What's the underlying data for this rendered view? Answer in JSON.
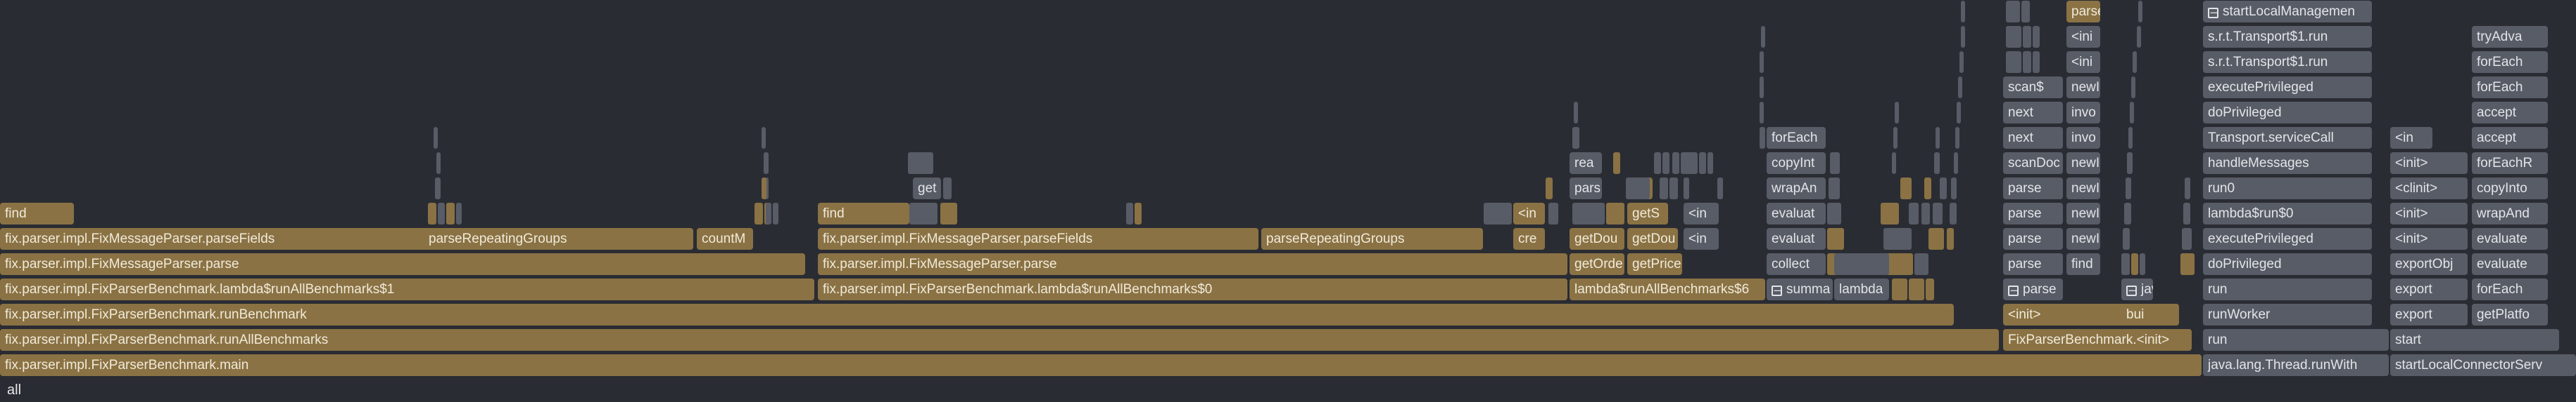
{
  "root_label": "all",
  "colors": {
    "app": "#8a7244",
    "lib": "#585c66",
    "background": "#2a2c33"
  },
  "collapse_icon": "minus-box-icon",
  "frames": [
    {
      "l": "fix.parser.impl.FixParserBenchmark.main",
      "c": "app"
    },
    {
      "l": "fix.parser.impl.FixParserBenchmark.runAllBenchmarks",
      "c": "app"
    },
    {
      "l": "fix.parser.impl.FixParserBenchmark.runBenchmark",
      "c": "app"
    },
    {
      "l": "fix.parser.impl.FixParserBenchmark.lambda$runAllBenchmarks$1",
      "c": "app"
    },
    {
      "l": "fix.parser.impl.FixMessageParser.parse",
      "c": "app"
    },
    {
      "l": "fix.parser.impl.FixMessageParser.parseFields",
      "c": "app"
    },
    {
      "l": "parseRepeatingGroups",
      "c": "app"
    },
    {
      "l": "countM",
      "c": "app"
    },
    {
      "l": "find",
      "c": "app"
    },
    {
      "l": "fix.parser.impl.FixParserBenchmark.lambda$runAllBenchmarks$0",
      "c": "app"
    },
    {
      "l": "fix.parser.impl.FixMessageParser.parse",
      "c": "app"
    },
    {
      "l": "fix.parser.impl.FixMessageParser.parseFields",
      "c": "app"
    },
    {
      "l": "parseRepeatingGroups",
      "c": "app"
    },
    {
      "l": "cre",
      "c": "app"
    },
    {
      "l": "<in",
      "c": "app"
    },
    {
      "l": "find",
      "c": "app"
    },
    {
      "l": "get",
      "c": "lib"
    },
    {
      "l": "lambda$runAllBenchmarks$6",
      "c": "app"
    },
    {
      "l": "getOrde",
      "c": "app"
    },
    {
      "l": "getPrice",
      "c": "app"
    },
    {
      "l": "getDou",
      "c": "app"
    },
    {
      "l": "getDou",
      "c": "app"
    },
    {
      "l": "getS",
      "c": "app"
    },
    {
      "l": "pars",
      "c": "lib"
    },
    {
      "l": "ind",
      "c": "app"
    },
    {
      "l": "rea",
      "c": "lib"
    },
    {
      "l": "<in",
      "c": "lib"
    },
    {
      "l": "<in",
      "c": "lib"
    },
    {
      "l": "summa",
      "c": "lib",
      "col": true
    },
    {
      "l": "collect",
      "c": "lib"
    },
    {
      "l": "evaluat",
      "c": "lib"
    },
    {
      "l": "evaluat",
      "c": "lib"
    },
    {
      "l": "wrapAn",
      "c": "lib"
    },
    {
      "l": "copyInt",
      "c": "lib"
    },
    {
      "l": "forEach",
      "c": "lib"
    },
    {
      "l": "lambda",
      "c": "lib"
    },
    {
      "l": "FixParserBenchmark.<init>",
      "c": "app"
    },
    {
      "l": "<init>",
      "c": "app"
    },
    {
      "l": "parse",
      "c": "lib",
      "col": true
    },
    {
      "l": "parse",
      "c": "lib"
    },
    {
      "l": "parse",
      "c": "lib"
    },
    {
      "l": "parse",
      "c": "lib"
    },
    {
      "l": "parse",
      "c": "lib"
    },
    {
      "l": "scanDoc",
      "c": "lib"
    },
    {
      "l": "next",
      "c": "lib"
    },
    {
      "l": "next",
      "c": "lib"
    },
    {
      "l": "scan$",
      "c": "lib"
    },
    {
      "l": "find",
      "c": "lib"
    },
    {
      "l": "newI",
      "c": "lib"
    },
    {
      "l": "newI",
      "c": "lib"
    },
    {
      "l": "newI",
      "c": "lib"
    },
    {
      "l": "newI",
      "c": "lib"
    },
    {
      "l": "invo",
      "c": "lib"
    },
    {
      "l": "invo",
      "c": "lib"
    },
    {
      "l": "newI",
      "c": "lib"
    },
    {
      "l": "<ini",
      "c": "lib"
    },
    {
      "l": "<ini",
      "c": "lib"
    },
    {
      "l": "parse",
      "c": "app"
    },
    {
      "l": "bui",
      "c": "app"
    },
    {
      "l": "java.lang.Thread.run",
      "c": "lib",
      "col": true
    },
    {
      "l": "java.lang.Thread.runWith",
      "c": "lib"
    },
    {
      "l": "run",
      "c": "lib"
    },
    {
      "l": "runWorker",
      "c": "lib"
    },
    {
      "l": "run",
      "c": "lib"
    },
    {
      "l": "doPrivileged",
      "c": "lib"
    },
    {
      "l": "executePrivileged",
      "c": "lib"
    },
    {
      "l": "lambda$run$0",
      "c": "lib"
    },
    {
      "l": "run0",
      "c": "lib"
    },
    {
      "l": "handleMessages",
      "c": "lib"
    },
    {
      "l": "Transport.serviceCall",
      "c": "lib"
    },
    {
      "l": "doPrivileged",
      "c": "lib"
    },
    {
      "l": "executePrivileged",
      "c": "lib"
    },
    {
      "l": "s.r.t.Transport$1.run",
      "c": "lib"
    },
    {
      "l": "s.r.t.Transport$1.run",
      "c": "lib"
    },
    {
      "l": "startLocalManagemen",
      "c": "lib",
      "col": true
    },
    {
      "l": "startLocalConnectorServ",
      "c": "lib"
    },
    {
      "l": "start",
      "c": "lib"
    },
    {
      "l": "export",
      "c": "lib"
    },
    {
      "l": "export",
      "c": "lib"
    },
    {
      "l": "exportObj",
      "c": "lib"
    },
    {
      "l": "<init>",
      "c": "lib"
    },
    {
      "l": "<init>",
      "c": "lib"
    },
    {
      "l": "<clinit>",
      "c": "lib"
    },
    {
      "l": "<init>",
      "c": "lib"
    },
    {
      "l": "<in",
      "c": "lib"
    },
    {
      "l": "getPlatfo",
      "c": "lib"
    },
    {
      "l": "forEach",
      "c": "lib"
    },
    {
      "l": "evaluate",
      "c": "lib"
    },
    {
      "l": "evaluate",
      "c": "lib"
    },
    {
      "l": "wrapAnd",
      "c": "lib"
    },
    {
      "l": "copyInto",
      "c": "lib"
    },
    {
      "l": "forEachR",
      "c": "lib"
    },
    {
      "l": "accept",
      "c": "lib"
    },
    {
      "l": "accept",
      "c": "lib"
    },
    {
      "l": "forEach",
      "c": "lib"
    },
    {
      "l": "forEach",
      "c": "lib"
    },
    {
      "l": "tryAdva",
      "c": "lib"
    }
  ],
  "blank_frame_count": 109
}
